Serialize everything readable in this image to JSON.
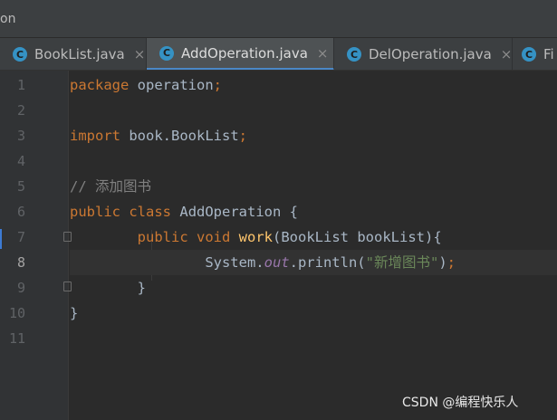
{
  "window": {
    "title_fragment": "on"
  },
  "tabs": [
    {
      "label": "BookList.java",
      "close": "×",
      "active": false
    },
    {
      "label": "AddOperation.java",
      "close": "×",
      "active": true
    },
    {
      "label": "DelOperation.java",
      "close": "×",
      "active": false
    },
    {
      "label": "Fi",
      "close": "",
      "active": false
    }
  ],
  "tab_icon_glyph": "C",
  "gutter": {
    "line_numbers": [
      "1",
      "2",
      "3",
      "4",
      "5",
      "6",
      "7",
      "8",
      "9",
      "10",
      "11"
    ],
    "current_line": "8"
  },
  "code": {
    "line1": {
      "kw": "package",
      "rest": " operation",
      "semi": ";"
    },
    "line3": {
      "kw": "import",
      "rest": " book.BookList",
      "semi": ";"
    },
    "line5": {
      "comment": "// 添加图书"
    },
    "line6": {
      "kw1": "public",
      "kw2": "class",
      "name": "AddOperation",
      "brace": " {"
    },
    "line7": {
      "kw1": "public",
      "kw2": "void",
      "method": "work",
      "params_open": "(BookList ",
      "param": "bookList",
      "params_close": "){"
    },
    "line8": {
      "obj": "System.",
      "field": "out",
      "call": ".println(",
      "string": "\"新增图书\"",
      "close": ")",
      "semi": ";"
    },
    "line9": {
      "brace": "}"
    },
    "line10": {
      "brace": "}"
    }
  },
  "watermark": "CSDN @编程快乐人",
  "colors": {
    "background": "#2b2b2b",
    "keyword": "#cc7832",
    "method": "#ffc66d",
    "string": "#6a8759",
    "field": "#9876aa",
    "comment": "#808080",
    "tab_icon": "#3592c4",
    "active_tab_underline": "#4a88c7"
  }
}
